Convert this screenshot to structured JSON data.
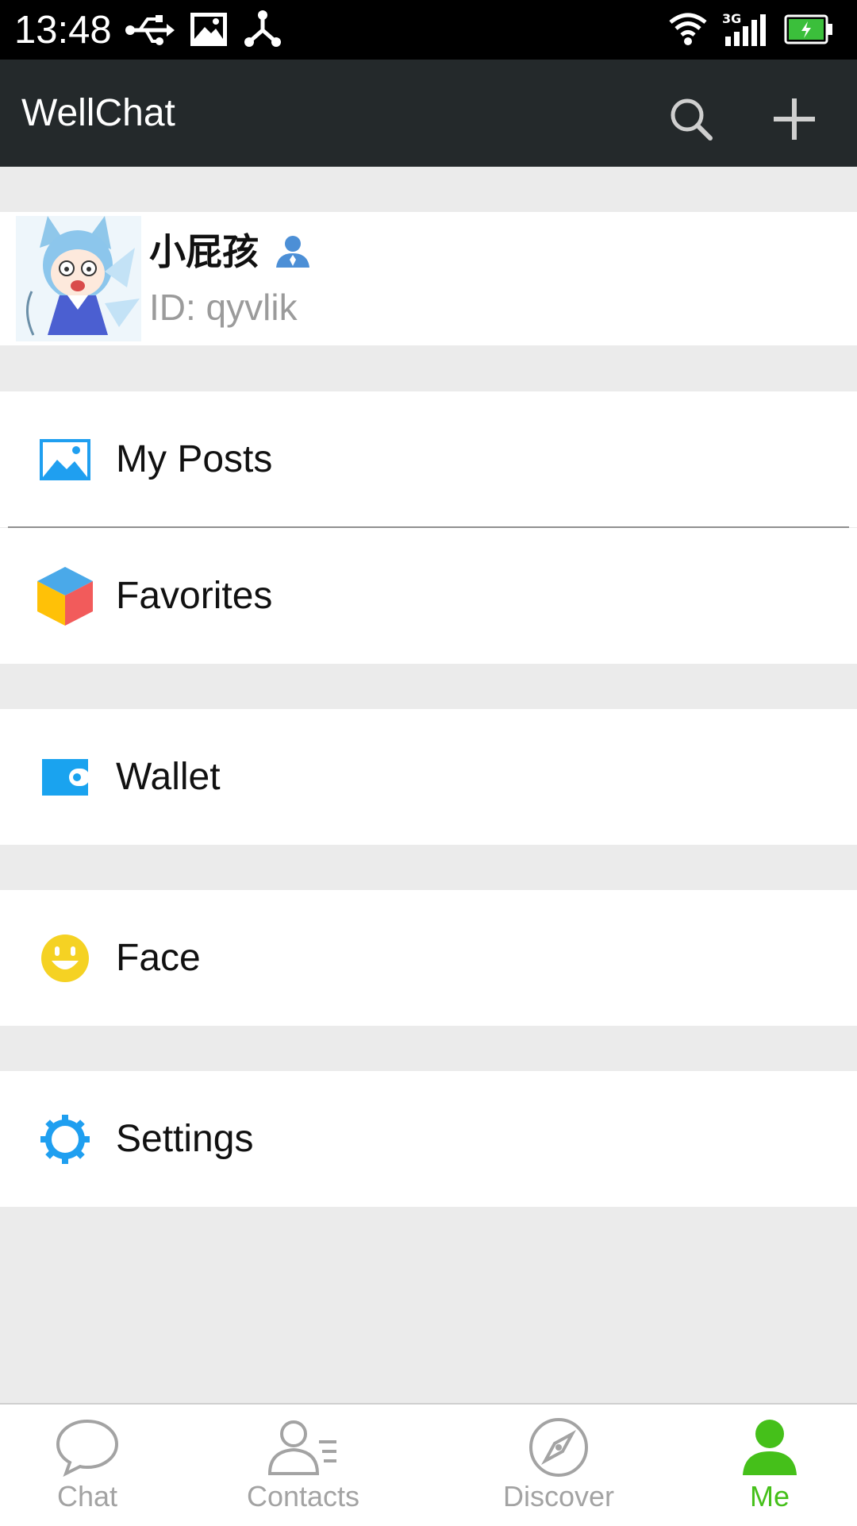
{
  "status_bar": {
    "time": "13:48",
    "network": "3G",
    "icons": [
      "usb-icon",
      "image-icon",
      "share-icon",
      "wifi-icon",
      "signal-icon",
      "battery-icon"
    ]
  },
  "app": {
    "title": "WellChat",
    "actions": [
      "search-icon",
      "plus-icon"
    ]
  },
  "profile": {
    "nickname": "小屁孩",
    "id": "ID: qyvlik"
  },
  "menu": [
    {
      "label": "My Posts",
      "icon": "photo-icon",
      "color": "#1f9ff0"
    },
    {
      "label": "Favorites",
      "icon": "cube-icon",
      "color": "#4aa9e9"
    },
    {
      "label": "Wallet",
      "icon": "wallet-icon",
      "color": "#1aa3ef"
    },
    {
      "label": "Face",
      "icon": "smiley-icon",
      "color": "#f5d223"
    },
    {
      "label": "Settings",
      "icon": "gear-icon",
      "color": "#1f9ff0"
    }
  ],
  "bottom_nav": {
    "tabs": [
      {
        "label": "Chat",
        "icon": "chat-bubble-icon"
      },
      {
        "label": "Contacts",
        "icon": "contacts-icon"
      },
      {
        "label": "Discover",
        "icon": "compass-icon"
      },
      {
        "label": "Me",
        "icon": "person-icon",
        "active": true
      }
    ],
    "active_color": "#45c01a",
    "inactive_color": "#a3a3a3"
  }
}
